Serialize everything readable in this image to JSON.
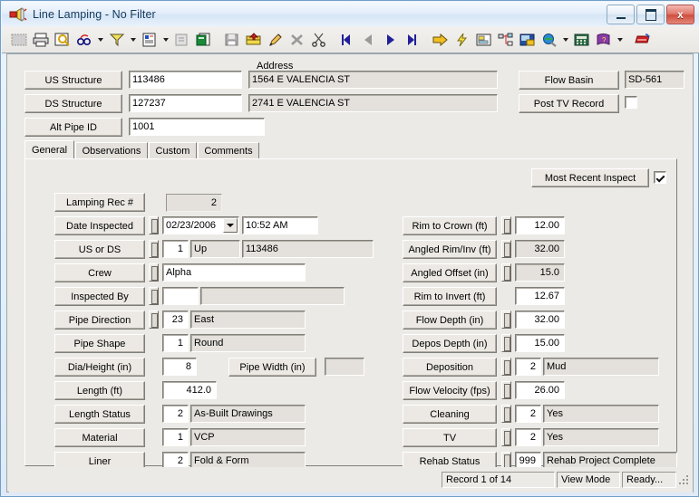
{
  "window": {
    "title": "Line Lamping - No Filter",
    "icon": "lamp-icon",
    "minimize_label": "Minimize",
    "maximize_label": "Maximize",
    "close_label": "x"
  },
  "toolbar": {
    "buttons": [
      {
        "name": "select-all-icon",
        "title": "Select"
      },
      {
        "name": "print-icon",
        "title": "Print"
      },
      {
        "name": "print-preview-icon",
        "title": "Print Preview"
      },
      {
        "name": "find-replace-icon",
        "title": "Find"
      },
      {
        "name": "find-dropdown-arrow",
        "title": "Find options"
      },
      {
        "name": "filter-icon",
        "title": "Filter"
      },
      {
        "name": "filter-dropdown-arrow",
        "title": "Filter options"
      },
      {
        "name": "report-icon",
        "title": "Report"
      },
      {
        "name": "report-dropdown-arrow",
        "title": "Report options"
      },
      {
        "name": "properties-icon",
        "title": "Properties"
      },
      {
        "name": "copy-record-icon",
        "title": "Copy Record"
      },
      {
        "name": "save-icon",
        "title": "Save"
      },
      {
        "name": "add-record-icon",
        "title": "Add Record"
      },
      {
        "name": "edit-icon",
        "title": "Edit"
      },
      {
        "name": "delete-icon",
        "title": "Delete"
      },
      {
        "name": "cut-icon",
        "title": "Cut"
      },
      {
        "name": "first-record-icon",
        "title": "First Record"
      },
      {
        "name": "previous-record-icon",
        "title": "Previous Record"
      },
      {
        "name": "next-record-icon",
        "title": "Next Record"
      },
      {
        "name": "last-record-icon",
        "title": "Last Record"
      },
      {
        "name": "goto-icon",
        "title": "Go To"
      },
      {
        "name": "lightning-icon",
        "title": "Quick Action"
      },
      {
        "name": "form-layout-icon",
        "title": "Form Layout"
      },
      {
        "name": "tree-view-icon",
        "title": "Tree View"
      },
      {
        "name": "image-viewer-icon",
        "title": "Image Viewer"
      },
      {
        "name": "map-globe-icon",
        "title": "Map"
      },
      {
        "name": "map-dropdown-arrow",
        "title": "Map options"
      },
      {
        "name": "calculator-icon",
        "title": "Calculator"
      },
      {
        "name": "help-book-icon",
        "title": "Help"
      },
      {
        "name": "help-dropdown-arrow",
        "title": "Help options"
      },
      {
        "name": "exit-icon",
        "title": "Exit"
      }
    ]
  },
  "header": {
    "address_caption": "Address",
    "rows": [
      {
        "label": "US Structure",
        "id": "113486",
        "address": "1564  E  VALENCIA ST"
      },
      {
        "label": "DS Structure",
        "id": "127237",
        "address": "2741  E  VALENCIA ST"
      },
      {
        "label": "Alt Pipe ID",
        "id": "1001",
        "address": ""
      }
    ],
    "flow_basin_label": "Flow Basin",
    "flow_basin_value": "SD-561",
    "post_tv_label": "Post TV Record",
    "post_tv_checked": false
  },
  "tabs": [
    {
      "label": "General",
      "active": true
    },
    {
      "label": "Observations",
      "active": false
    },
    {
      "label": "Custom",
      "active": false
    },
    {
      "label": "Comments",
      "active": false
    }
  ],
  "general": {
    "most_recent_label": "Most Recent Inspect",
    "most_recent_checked": true,
    "left_rows": [
      {
        "label": "Lamping Rec #",
        "spinner": false,
        "code": "",
        "value": "2",
        "value_readonly": true,
        "value_numeric": true,
        "desc": null
      },
      {
        "label": "Date Inspected",
        "spinner": true,
        "code": "",
        "value": "02/23/2006",
        "combo": true,
        "time": "10:52 AM",
        "desc": null
      },
      {
        "label": "US or DS",
        "spinner": true,
        "code": "1",
        "desc": "Up",
        "extra": "113486"
      },
      {
        "label": "Crew",
        "spinner": true,
        "code": "",
        "value": "Alpha",
        "wide": true,
        "desc": null
      },
      {
        "label": "Inspected By",
        "spinner": true,
        "code": "",
        "desc": "",
        "blankcode": true
      },
      {
        "label": "Pipe Direction",
        "spinner": true,
        "code": "23",
        "desc": "East"
      },
      {
        "label": "Pipe Shape",
        "spinner": false,
        "code": "1",
        "desc": "Round"
      },
      {
        "label": "Dia/Height (in)",
        "spinner": false,
        "code": "8",
        "desc": null,
        "sublabel": "Pipe Width (in)",
        "subvalue": ""
      },
      {
        "label": "Length (ft)",
        "spinner": false,
        "code": "412.0",
        "wideval": true,
        "desc": null
      },
      {
        "label": "Length Status",
        "spinner": false,
        "code": "2",
        "desc": "As-Built Drawings"
      },
      {
        "label": "Material",
        "spinner": false,
        "code": "1",
        "desc": "VCP"
      },
      {
        "label": "Liner",
        "spinner": false,
        "code": "2",
        "desc": "Fold & Form"
      }
    ],
    "right_rows": [
      {
        "label": "Rim to Crown (ft)",
        "spinner": true,
        "value": "12.00",
        "readonly": false
      },
      {
        "label": "Angled Rim/Inv (ft)",
        "spinner": true,
        "value": "32.00",
        "readonly": true
      },
      {
        "label": "Angled Offset (in)",
        "spinner": true,
        "value": "15.0",
        "readonly": true
      },
      {
        "label": "Rim to Invert (ft)",
        "spinner": false,
        "value": "12.67",
        "readonly": false
      },
      {
        "label": "Flow Depth (in)",
        "spinner": true,
        "value": "32.00",
        "readonly": false
      },
      {
        "label": "Depos Depth (in)",
        "spinner": true,
        "value": "15.00",
        "readonly": false
      },
      {
        "label": "Deposition",
        "spinner": true,
        "value": "2",
        "desc": "Mud"
      },
      {
        "label": "Flow Velocity (fps)",
        "spinner": true,
        "value": "26.00",
        "readonly": false
      },
      {
        "label": "Cleaning",
        "spinner": true,
        "value": "2",
        "desc": "Yes"
      },
      {
        "label": "TV",
        "spinner": true,
        "value": "2",
        "desc": "Yes"
      },
      {
        "label": "Rehab Status",
        "spinner": true,
        "value": "999",
        "desc": "Rehab Project Complete"
      }
    ]
  },
  "statusbar": {
    "record": "Record 1 of 14",
    "mode": "View Mode",
    "state": "Ready..."
  }
}
